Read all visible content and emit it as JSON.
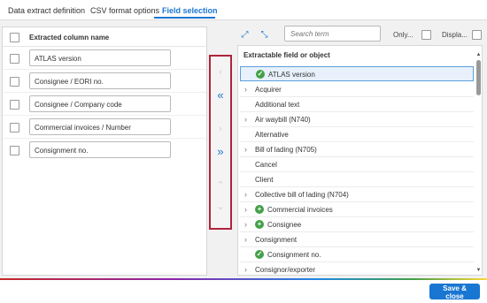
{
  "tabs": [
    {
      "label": "Data extract definition"
    },
    {
      "label": "CSV format options"
    },
    {
      "label": "Field selection"
    }
  ],
  "left_panel": {
    "header": "Extracted column name",
    "rows": [
      {
        "value": "ATLAS version"
      },
      {
        "value": "Consignee / EORI no."
      },
      {
        "value": "Consignee / Company code"
      },
      {
        "value": "Commercial invoices / Number"
      },
      {
        "value": "Consignment no."
      }
    ]
  },
  "toolbar": {
    "search_placeholder": "Search term",
    "only_label": "Only...",
    "display_label": "Displa..."
  },
  "right_panel": {
    "header": "Extractable field or object",
    "items": [
      {
        "label": "ATLAS version",
        "icon": "check-circle-icon",
        "expandable": false,
        "selected": true
      },
      {
        "label": "Acquirer",
        "icon": "",
        "expandable": true
      },
      {
        "label": "Additional text",
        "icon": "",
        "expandable": false
      },
      {
        "label": "Air waybill (N740)",
        "icon": "",
        "expandable": true
      },
      {
        "label": "Alternative",
        "icon": "",
        "expandable": false
      },
      {
        "label": "Bill of lading (N705)",
        "icon": "",
        "expandable": true
      },
      {
        "label": "Cancel",
        "icon": "",
        "expandable": false
      },
      {
        "label": "Client",
        "icon": "",
        "expandable": false
      },
      {
        "label": "Collective bill of lading (N704)",
        "icon": "",
        "expandable": true
      },
      {
        "label": "Commercial invoices",
        "icon": "plus-circle-icon",
        "expandable": true
      },
      {
        "label": "Consignee",
        "icon": "plus-circle-icon",
        "expandable": true
      },
      {
        "label": "Consignment",
        "icon": "",
        "expandable": true
      },
      {
        "label": "Consignment no.",
        "icon": "check-circle-icon",
        "expandable": false
      },
      {
        "label": "Consignor/exporter",
        "icon": "",
        "expandable": true
      }
    ]
  },
  "footer": {
    "save_label": "Save & close"
  },
  "colors": {
    "accent": "#1976d2",
    "highlight_border": "#b0243a",
    "check_green": "#43a047"
  }
}
